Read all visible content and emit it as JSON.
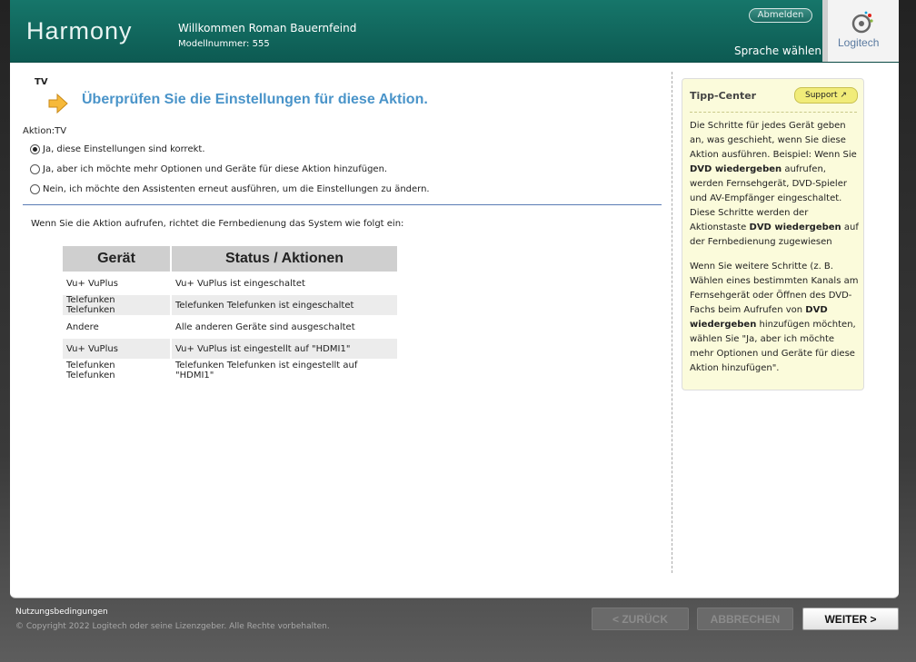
{
  "header": {
    "logo_text": "Harmony",
    "welcome": "Willkommen Roman Bauernfeind",
    "model": "Modellnummer: 555",
    "logout_label": "Abmelden",
    "language_label": "Sprache wählen",
    "brand_name": "Logitech"
  },
  "main": {
    "device_label": "TV",
    "heading": "Überprüfen Sie die Einstellungen für diese Aktion.",
    "action_line": "Aktion:TV",
    "options": [
      {
        "label": "Ja, diese Einstellungen sind korrekt.",
        "checked": true
      },
      {
        "label": "Ja, aber ich möchte mehr Optionen und Geräte für diese Aktion hinzufügen.",
        "checked": false
      },
      {
        "label": "Nein, ich möchte den Assistenten erneut ausführen, um die Einstellungen zu ändern.",
        "checked": false
      }
    ],
    "system_intro": "Wenn Sie die Aktion aufrufen, richtet die Fernbedienung das System wie folgt ein:",
    "table": {
      "headers": [
        "Gerät",
        "Status / Aktionen"
      ],
      "rows": [
        [
          "Vu+ VuPlus",
          "Vu+ VuPlus ist eingeschaltet"
        ],
        [
          "Telefunken Telefunken",
          "Telefunken Telefunken ist eingeschaltet"
        ],
        [
          "Andere",
          "Alle anderen Geräte sind ausgeschaltet"
        ],
        [
          "Vu+ VuPlus",
          "Vu+ VuPlus  ist eingestellt auf \"HDMI1\""
        ],
        [
          "Telefunken Telefunken",
          "Telefunken Telefunken  ist eingestellt auf \"HDMI1\""
        ]
      ]
    }
  },
  "tip": {
    "title": "Tipp-Center",
    "support_label": "Support",
    "p1_a": "Die Schritte für jedes Gerät geben an, was geschieht, wenn Sie diese Aktion ausführen. Beispiel: Wenn Sie ",
    "p1_b": "DVD wiedergeben",
    "p1_c": " aufrufen, werden Fernsehgerät, DVD-Spieler und AV-Empfänger eingeschaltet. Diese Schritte werden der Aktionstaste ",
    "p1_d": "DVD wiedergeben",
    "p1_e": " auf der Fernbedienung zugewiesen",
    "p2_a": "Wenn Sie weitere Schritte (z. B. Wählen eines bestimmten Kanals am Fernsehgerät oder Öffnen des DVD-Fachs beim Aufrufen von ",
    "p2_b": "DVD wiedergeben",
    "p2_c": " hinzufügen möchten, wählen Sie \"Ja, aber ich möchte mehr Optionen und Geräte für diese Aktion hinzufügen\"."
  },
  "footer": {
    "terms": "Nutzungsbedingungen",
    "copyright": "© Copyright 2022 Logitech oder seine Lizenzgeber. Alle Rechte vorbehalten.",
    "back_label": "< ZURÜCK",
    "cancel_label": "ABBRECHEN",
    "next_label": "WEITER >"
  }
}
